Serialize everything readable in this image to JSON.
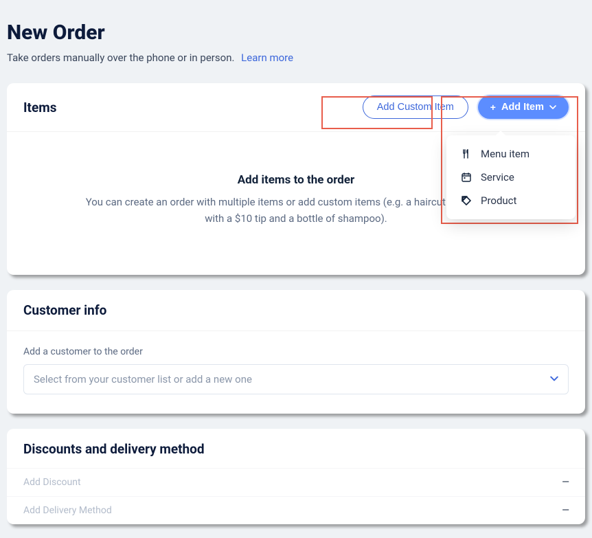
{
  "header": {
    "title": "New Order",
    "subtitle": "Take orders manually over the phone or in person.",
    "learn_more": "Learn more"
  },
  "items_card": {
    "title": "Items",
    "add_custom_label": "Add Custom Item",
    "add_item_label": "Add Item",
    "empty_title": "Add items to the order",
    "empty_desc": "You can create an order with multiple items or add custom items (e.g. a haircut appointment with a $10 tip and a bottle of shampoo).",
    "dropdown": [
      {
        "icon": "utensils",
        "label": "Menu item"
      },
      {
        "icon": "calendar",
        "label": "Service"
      },
      {
        "icon": "tag",
        "label": "Product"
      }
    ]
  },
  "customer_card": {
    "title": "Customer info",
    "field_label": "Add a customer to the order",
    "select_placeholder": "Select from your customer list or add a new one"
  },
  "discounts_card": {
    "title": "Discounts and delivery method",
    "rows": [
      {
        "label": "Add Discount"
      },
      {
        "label": "Add Delivery Method"
      }
    ]
  }
}
